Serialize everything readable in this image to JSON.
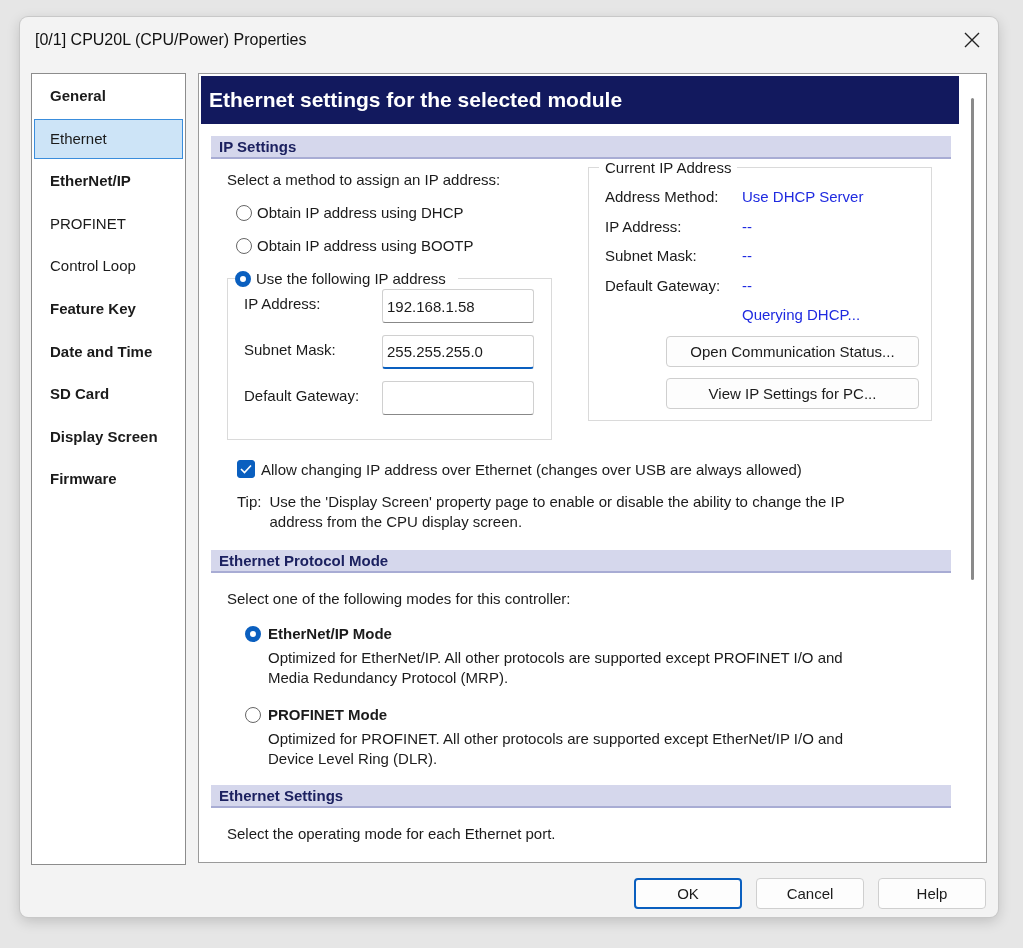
{
  "window": {
    "title": "[0/1] CPU20L (CPU/Power) Properties"
  },
  "sidebar": {
    "items": [
      {
        "label": "General",
        "bold": true,
        "selected": false
      },
      {
        "label": "Ethernet",
        "bold": false,
        "selected": true
      },
      {
        "label": "EtherNet/IP",
        "bold": true,
        "selected": false
      },
      {
        "label": "PROFINET",
        "bold": false,
        "selected": false
      },
      {
        "label": "Control Loop",
        "bold": false,
        "selected": false
      },
      {
        "label": "Feature Key",
        "bold": true,
        "selected": false
      },
      {
        "label": "Date and Time",
        "bold": true,
        "selected": false
      },
      {
        "label": "SD Card",
        "bold": true,
        "selected": false
      },
      {
        "label": "Display Screen",
        "bold": true,
        "selected": false
      },
      {
        "label": "Firmware",
        "bold": true,
        "selected": false
      }
    ]
  },
  "page": {
    "title": "Ethernet settings for the selected module",
    "ip_settings": {
      "heading": "IP Settings",
      "prompt": "Select a method to assign an IP address:",
      "methods": [
        {
          "label": "Obtain IP address using DHCP",
          "selected": false
        },
        {
          "label": "Obtain IP address using BOOTP",
          "selected": false
        },
        {
          "label": "Use the following IP address",
          "selected": true
        }
      ],
      "fields": [
        {
          "label": "IP Address:",
          "value": "192.168.1.58",
          "focused": false
        },
        {
          "label": "Subnet Mask:",
          "value": "255.255.255.0",
          "focused": true
        },
        {
          "label": "Default Gateway:",
          "focused": false
        }
      ],
      "current": {
        "legend": "Current IP Address",
        "rows": [
          {
            "label": "Address Method:",
            "value": "Use DHCP Server"
          },
          {
            "label": "IP Address:",
            "value": "--"
          },
          {
            "label": "Subnet Mask:",
            "value": "--"
          },
          {
            "label": "Default Gateway:",
            "value": "--"
          }
        ],
        "status": "Querying DHCP...",
        "buttons": [
          "Open Communication Status...",
          "View IP Settings for PC..."
        ]
      },
      "allow_change": {
        "label": "Allow changing IP address over Ethernet (changes over USB are always allowed)",
        "checked": true
      },
      "tip": {
        "label": "Tip:",
        "text": "Use the 'Display Screen' property page to enable or disable the ability to change the IP address from the CPU display screen."
      }
    },
    "protocol_mode": {
      "heading": "Ethernet Protocol Mode",
      "prompt": "Select one of the following modes for this controller:",
      "modes": [
        {
          "label": "EtherNet/IP Mode",
          "description": "Optimized for EtherNet/IP. All other protocols are supported except PROFINET I/O and Media Redundancy Protocol (MRP).",
          "selected": true
        },
        {
          "label": "PROFINET Mode",
          "description": "Optimized for PROFINET. All other protocols are supported except EtherNet/IP I/O and Device Level Ring (DLR).",
          "selected": false
        }
      ]
    },
    "ethernet_settings": {
      "heading": "Ethernet Settings",
      "prompt": "Select the operating mode for each Ethernet port."
    }
  },
  "buttons": [
    {
      "label": "OK",
      "default": true
    },
    {
      "label": "Cancel",
      "default": false
    },
    {
      "label": "Help",
      "default": false
    }
  ]
}
